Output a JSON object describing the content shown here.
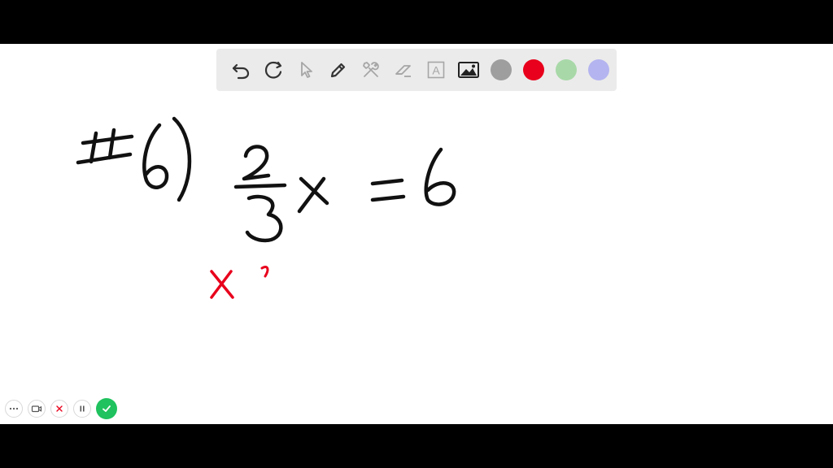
{
  "toolbar": {
    "tools": [
      {
        "icon": "undo-icon"
      },
      {
        "icon": "redo-icon"
      },
      {
        "icon": "pointer-icon"
      },
      {
        "icon": "pen-icon"
      },
      {
        "icon": "tools-icon"
      },
      {
        "icon": "eraser-icon"
      },
      {
        "icon": "text-icon",
        "glyph": "A"
      },
      {
        "icon": "image-icon"
      }
    ],
    "colors": [
      "#9e9e9e",
      "#e8001c",
      "#a8d8a8",
      "#b4b4f0"
    ],
    "active_color": "#e8001c"
  },
  "ink": {
    "black": "#111111",
    "red": "#e8001c"
  },
  "controls": [
    {
      "icon": "more-icon"
    },
    {
      "icon": "camera-icon"
    },
    {
      "icon": "close-icon"
    },
    {
      "icon": "pause-icon"
    },
    {
      "icon": "check-icon",
      "color": "#1fc25e"
    }
  ]
}
